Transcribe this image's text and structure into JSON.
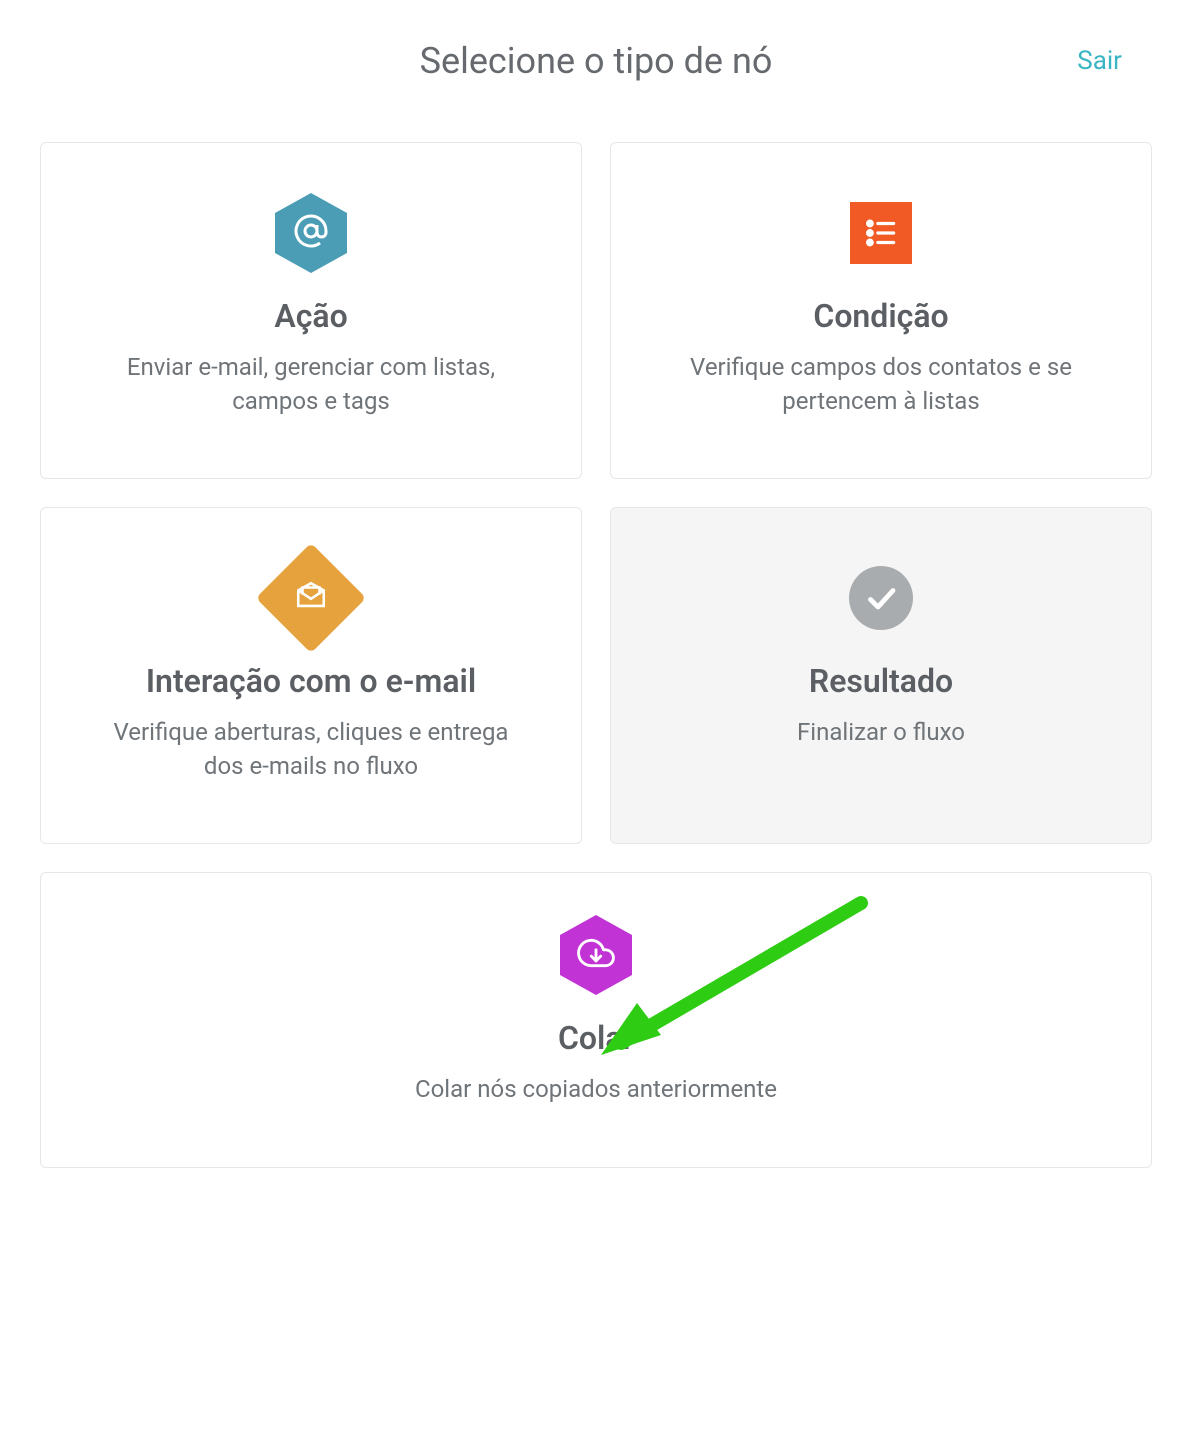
{
  "header": {
    "title": "Selecione o tipo de nó",
    "exit_label": "Sair"
  },
  "cards": {
    "action": {
      "title": "Ação",
      "desc": "Enviar e-mail, gerenciar com listas, campos e tags"
    },
    "condition": {
      "title": "Condição",
      "desc": "Verifique campos dos contatos e se pertencem à listas"
    },
    "email_interaction": {
      "title": "Interação com o e-mail",
      "desc": "Verifique aberturas, cliques e entrega dos e-mails no fluxo"
    },
    "result": {
      "title": "Resultado",
      "desc": "Finalizar o fluxo"
    },
    "paste": {
      "title": "Colar",
      "desc": "Colar nós copiados anteriormente"
    }
  }
}
